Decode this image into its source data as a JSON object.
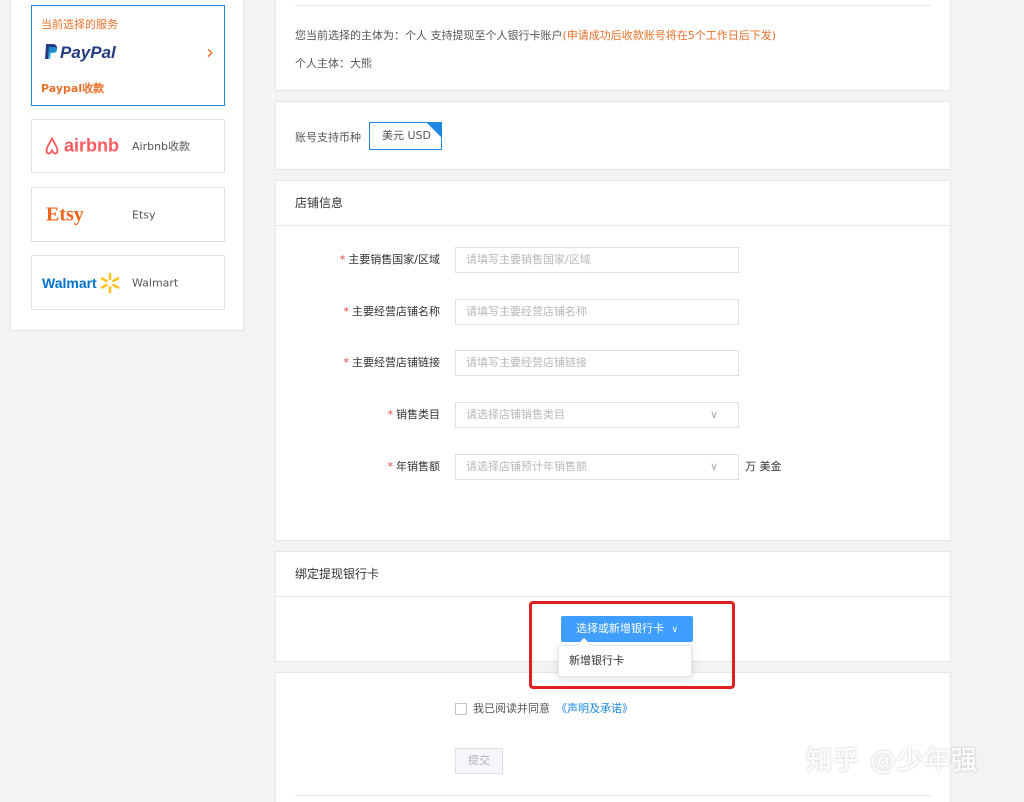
{
  "sidebar": {
    "current_service_label": "当前选择的服务",
    "selected": {
      "logo": "PayPal",
      "label": "Paypal收款",
      "arrow": "›"
    },
    "items": [
      {
        "logo": "airbnb",
        "name": "Airbnb收款"
      },
      {
        "logo": "Etsy",
        "name": "Etsy"
      },
      {
        "logo": "Walmart",
        "name": "Walmart"
      }
    ]
  },
  "entity": {
    "line1": "您当前选择的主体为：个人 支持提现至个人银行卡账户",
    "line1_warn": "(申请成功后收款账号将在5个工作日后下发)",
    "line2": "个人主体：大熊"
  },
  "currency": {
    "label": "账号支持币种",
    "value": "美元 USD"
  },
  "store": {
    "title": "店铺信息",
    "fields": [
      {
        "label": "主要销售国家/区域",
        "placeholder": "请填写主要销售国家/区域",
        "type": "text"
      },
      {
        "label": "主要经营店铺名称",
        "placeholder": "请填写主要经营店铺名称",
        "type": "text"
      },
      {
        "label": "主要经营店铺链接",
        "placeholder": "请填写主要经营店铺链接",
        "type": "text"
      },
      {
        "label": "销售类目",
        "placeholder": "请选择店铺销售类目",
        "type": "select"
      },
      {
        "label": "年销售额",
        "placeholder": "请选择店铺预计年销售额",
        "type": "select",
        "unit": "万 美金"
      }
    ]
  },
  "bank": {
    "title": "绑定提现银行卡",
    "button_label": "选择或新增银行卡",
    "button_chevron": "∨",
    "dropdown_item": "新增银行卡"
  },
  "agreement": {
    "text": "我已阅读并同意",
    "link": "《声明及承诺》",
    "submit_label": "提交"
  },
  "watermark": "知乎 @少年强",
  "colors": {
    "accent": "#409eff",
    "warning": "#e8712b",
    "required": "#e64340",
    "highlight": "#e02020"
  }
}
